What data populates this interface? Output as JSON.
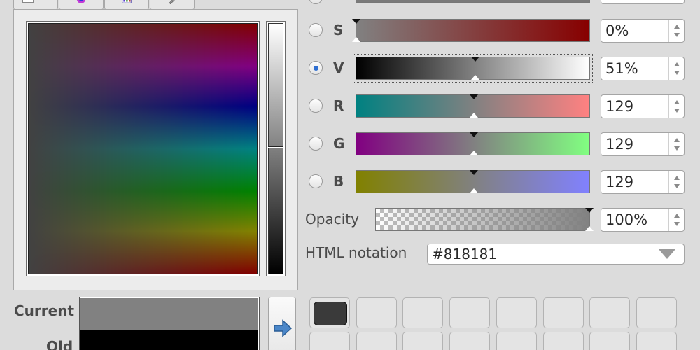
{
  "channels": [
    {
      "label": "S",
      "value": "0%",
      "selected": false,
      "pos": 0.0
    },
    {
      "label": "V",
      "value": "51%",
      "selected": true,
      "pos": 0.51
    },
    {
      "label": "R",
      "value": "129",
      "selected": false,
      "pos": 0.506
    },
    {
      "label": "G",
      "value": "129",
      "selected": false,
      "pos": 0.506
    },
    {
      "label": "B",
      "value": "129",
      "selected": false,
      "pos": 0.506
    }
  ],
  "opacity": {
    "label": "Opacity",
    "value": "100%",
    "pos": 1.0
  },
  "html_notation": {
    "label": "HTML notation",
    "value": "#818181"
  },
  "swatches": {
    "current_label": "Current",
    "old_label": "Old",
    "current_color": "#818181",
    "old_color": "#000000"
  },
  "colors": {
    "accent": "#2f6fd1",
    "selected_hex": "#818181"
  },
  "palette": {
    "rows": 2,
    "cols": 8,
    "filled_index": 0,
    "filled_color": "#3a3a3a"
  },
  "icons": [
    "color-wheel-icon",
    "palette-icon",
    "eyedropper-icon",
    "arrow-right-icon",
    "dropdown-arrow-icon"
  ]
}
